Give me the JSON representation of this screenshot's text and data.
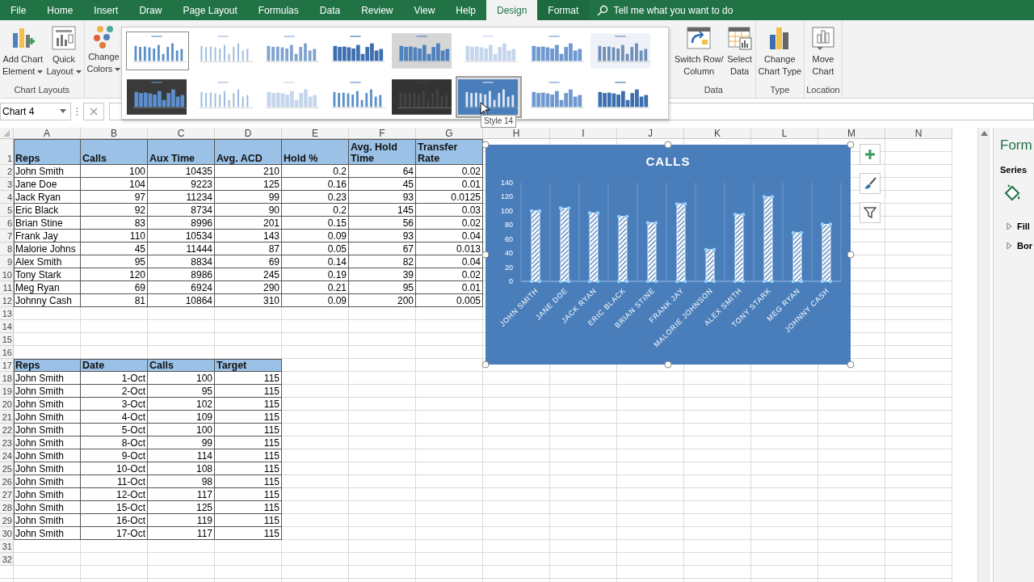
{
  "ribbon_tabs": [
    {
      "label": "File",
      "selected": false
    },
    {
      "label": "Home",
      "selected": false
    },
    {
      "label": "Insert",
      "selected": false
    },
    {
      "label": "Draw",
      "selected": false
    },
    {
      "label": "Page Layout",
      "selected": false
    },
    {
      "label": "Formulas",
      "selected": false
    },
    {
      "label": "Data",
      "selected": false
    },
    {
      "label": "Review",
      "selected": false
    },
    {
      "label": "View",
      "selected": false
    },
    {
      "label": "Help",
      "selected": false
    },
    {
      "label": "Design",
      "selected": true
    },
    {
      "label": "Format",
      "selected": false
    }
  ],
  "tell_me": {
    "placeholder": "Tell me what you want to do"
  },
  "left_groups": [
    {
      "label": "Chart Layouts",
      "buttons": [
        {
          "kind": "add_element",
          "lines": [
            "Add Chart",
            "Element"
          ],
          "dropdown": true
        },
        {
          "kind": "quick_layout",
          "lines": [
            "Quick",
            "Layout"
          ],
          "dropdown": true
        }
      ]
    },
    {
      "buttons": [
        {
          "kind": "colors",
          "lines": [
            "Change",
            "Colors"
          ],
          "dropdown": true
        }
      ]
    }
  ],
  "right_groups": [
    {
      "label": "Data",
      "buttons": [
        {
          "kind": "switch",
          "lines": [
            "Switch Row/",
            "Column"
          ],
          "dropdown": false
        },
        {
          "kind": "select_data",
          "lines": [
            "Select",
            "Data"
          ],
          "dropdown": false
        }
      ]
    },
    {
      "label": "Type",
      "buttons": [
        {
          "kind": "chart_type",
          "lines": [
            "Change",
            "Chart Type"
          ],
          "dropdown": false
        }
      ]
    },
    {
      "label": "Location",
      "buttons": [
        {
          "kind": "move",
          "lines": [
            "Move",
            "Chart"
          ],
          "dropdown": false
        }
      ]
    }
  ],
  "chart_styles": [
    {
      "kind": "light",
      "selected": true,
      "hovered": false
    },
    {
      "kind": "thin",
      "selected": false,
      "hovered": false
    },
    {
      "kind": "dotted",
      "selected": false,
      "hovered": false
    },
    {
      "kind": "solid",
      "selected": false,
      "hovered": false
    },
    {
      "kind": "gray",
      "selected": false,
      "hovered": false
    },
    {
      "kind": "pale",
      "selected": false,
      "hovered": false
    },
    {
      "kind": "gradient",
      "selected": false,
      "hovered": false
    },
    {
      "kind": "striped",
      "selected": false,
      "hovered": false
    },
    {
      "kind": "dark",
      "selected": false,
      "hovered": false
    },
    {
      "kind": "thin",
      "selected": false,
      "hovered": false
    },
    {
      "kind": "pale",
      "selected": false,
      "hovered": false
    },
    {
      "kind": "light",
      "selected": false,
      "hovered": false
    },
    {
      "kind": "black",
      "selected": false,
      "hovered": false
    },
    {
      "kind": "blue",
      "selected": false,
      "hovered": true
    },
    {
      "kind": "gradient",
      "selected": false,
      "hovered": false
    },
    {
      "kind": "solid",
      "selected": false,
      "hovered": false
    }
  ],
  "tooltip": "Style 14",
  "name_box": "Chart 4",
  "column_letters": [
    "A",
    "B",
    "C",
    "D",
    "E",
    "F",
    "G",
    "H",
    "I",
    "J",
    "K",
    "L",
    "M",
    "N"
  ],
  "row_numbers": [
    "1",
    "2",
    "3",
    "4",
    "5",
    "6",
    "7",
    "8",
    "9",
    "10",
    "11",
    "12",
    "13",
    "14",
    "15",
    "16",
    "17",
    "18",
    "19",
    "20",
    "21",
    "22",
    "23",
    "24",
    "25",
    "26",
    "27",
    "28",
    "29",
    "30",
    "31",
    "32"
  ],
  "table_1": {
    "columns": [
      "Reps",
      "Calls",
      "Aux Time",
      "Avg. ACD",
      "Hold %",
      "Avg. Hold Time",
      "Transfer Rate"
    ],
    "rows": [
      [
        "John Smith",
        "100",
        "10435",
        "210",
        "0.2",
        "64",
        "0.02"
      ],
      [
        "Jane Doe",
        "104",
        "9223",
        "125",
        "0.16",
        "45",
        "0.01"
      ],
      [
        "Jack Ryan",
        "97",
        "11234",
        "99",
        "0.23",
        "93",
        "0.0125"
      ],
      [
        "Eric Black",
        "92",
        "8734",
        "90",
        "0.2",
        "145",
        "0.03"
      ],
      [
        "Brian Stine",
        "83",
        "8996",
        "201",
        "0.15",
        "56",
        "0.02"
      ],
      [
        "Frank Jay",
        "110",
        "10534",
        "143",
        "0.09",
        "93",
        "0.04"
      ],
      [
        "Malorie Johns",
        "45",
        "11444",
        "87",
        "0.05",
        "67",
        "0.013"
      ],
      [
        "Alex Smith",
        "95",
        "8834",
        "69",
        "0.14",
        "82",
        "0.04"
      ],
      [
        "Tony Stark",
        "120",
        "8986",
        "245",
        "0.19",
        "39",
        "0.02"
      ],
      [
        "Meg Ryan",
        "69",
        "6924",
        "290",
        "0.21",
        "95",
        "0.01"
      ],
      [
        "Johnny Cash",
        "81",
        "10864",
        "310",
        "0.09",
        "200",
        "0.005"
      ]
    ]
  },
  "table_2": {
    "columns": [
      "Reps",
      "Date",
      "Calls",
      "Target"
    ],
    "rows": [
      [
        "John Smith",
        "1-Oct",
        "100",
        "115"
      ],
      [
        "John Smith",
        "2-Oct",
        "95",
        "115"
      ],
      [
        "John Smith",
        "3-Oct",
        "102",
        "115"
      ],
      [
        "John Smith",
        "4-Oct",
        "109",
        "115"
      ],
      [
        "John Smith",
        "5-Oct",
        "100",
        "115"
      ],
      [
        "John Smith",
        "8-Oct",
        "99",
        "115"
      ],
      [
        "John Smith",
        "9-Oct",
        "114",
        "115"
      ],
      [
        "John Smith",
        "10-Oct",
        "108",
        "115"
      ],
      [
        "John Smith",
        "11-Oct",
        "98",
        "115"
      ],
      [
        "John Smith",
        "12-Oct",
        "117",
        "115"
      ],
      [
        "John Smith",
        "15-Oct",
        "125",
        "115"
      ],
      [
        "John Smith",
        "16-Oct",
        "119",
        "115"
      ],
      [
        "John Smith",
        "17-Oct",
        "117",
        "115"
      ]
    ]
  },
  "chart": {
    "selected": true,
    "chart_data": {
      "type": "bar",
      "title": "CALLS",
      "categories": [
        "JOHN SMITH",
        "JANE DOE",
        "JACK RYAN",
        "ERIC BLACK",
        "BRIAN STINE",
        "FRANK JAY",
        "MALORIE JOHNSON",
        "ALEX SMITH",
        "TONY STARK",
        "MEG RYAN",
        "JOHNNY CASH"
      ],
      "series": [
        {
          "color": "#ffffff",
          "values": [
            100,
            104,
            97,
            92,
            83,
            110,
            45,
            95,
            120,
            69,
            81
          ]
        }
      ],
      "ylim": [
        0,
        140
      ],
      "yticks": [
        0,
        20,
        40,
        60,
        80,
        100,
        120,
        140
      ]
    },
    "side_buttons": [
      {
        "kind": "add"
      },
      {
        "kind": "style"
      },
      {
        "kind": "filter"
      }
    ]
  },
  "format_pane": {
    "title": "Form",
    "subtitle": "Series",
    "sections": [
      {
        "label": "Fill",
        "expanded": false
      },
      {
        "label": "Bor",
        "expanded": false
      }
    ]
  }
}
